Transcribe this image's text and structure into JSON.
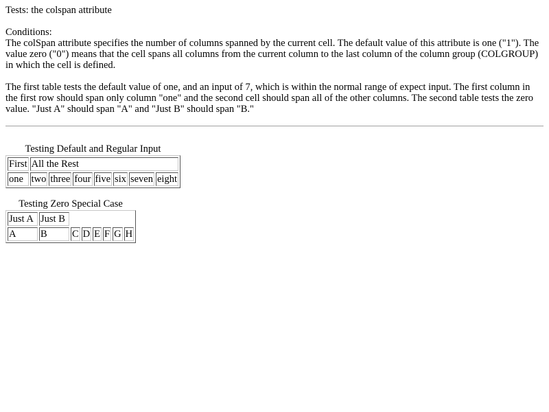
{
  "heading": "Tests: the colspan attribute",
  "conditions_label": "Conditions:",
  "paragraph1": "The colSpan attribute specifies the number of columns spanned by the current cell. The default value of this attribute is one (\"1\"). The value zero (\"0\") means that the cell spans all columns from the current column to the last column of the column group (COLGROUP) in which the cell is defined.",
  "paragraph2": "The first table tests the default value of one, and an input of 7, which is within the normal range of expect input. The first column in the first row should span only column \"one\" and the second cell should span all of the other columns. The second table tests the zero value. \"Just A\" should span \"A\" and \"Just B\" should span \"B.\"",
  "table1": {
    "caption": "Testing Default and Regular Input",
    "header_row": [
      "First",
      "All the Rest"
    ],
    "body_row": [
      "one",
      "two",
      "three",
      "four",
      "five",
      "six",
      "seven",
      "eight"
    ]
  },
  "table2": {
    "caption": "Testing Zero Special Case",
    "header_row": [
      "Just A",
      "Just B"
    ],
    "body_row": [
      "A",
      "B",
      "C",
      "D",
      "E",
      "F",
      "G",
      "H"
    ]
  }
}
